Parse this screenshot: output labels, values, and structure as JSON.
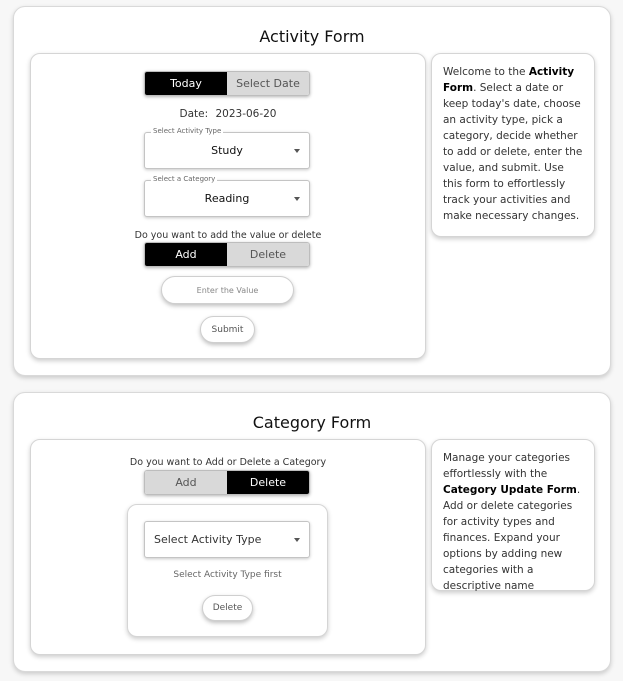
{
  "activity_form": {
    "title": "Activity Form",
    "date_toggle": {
      "today_label": "Today",
      "select_date_label": "Select Date",
      "selected": "Today"
    },
    "date_label": "Date:",
    "date_value": "2023-06-20",
    "activity_type": {
      "legend": "Select Activity Type",
      "value": "Study"
    },
    "category": {
      "legend": "Select a Category",
      "value": "Reading"
    },
    "mode_prompt": "Do you want to add the value or delete",
    "mode_toggle": {
      "add_label": "Add",
      "delete_label": "Delete",
      "selected": "Add"
    },
    "value_input": {
      "placeholder": "Enter the Value",
      "value": ""
    },
    "submit_label": "Submit",
    "info": {
      "part1": "Welcome to the ",
      "bold": "Activity Form",
      "part2": ". Select a date or keep today's date, choose an activity type, pick a category, decide whether to add or delete, enter the value, and submit. Use this form to effortlessly track your activities and make necessary changes."
    }
  },
  "category_form": {
    "title": "Category Form",
    "mode_prompt": "Do you want to Add or Delete a Category",
    "mode_toggle": {
      "add_label": "Add",
      "delete_label": "Delete",
      "selected": "Delete"
    },
    "activity_type_select": {
      "value": "Select Activity Type"
    },
    "hint": "Select Activity Type first",
    "delete_label": "Delete",
    "info": {
      "part1": "Manage your categories effortlessly with the ",
      "bold": "Category Update Form",
      "part2": ". Add or delete categories for activity types and finances. Expand your options by adding new categories with a descriptive name"
    }
  },
  "colors": {
    "active_toggle": "#000000",
    "inactive_toggle": "#d9d9d9",
    "page_background": "#f7f7f7"
  }
}
